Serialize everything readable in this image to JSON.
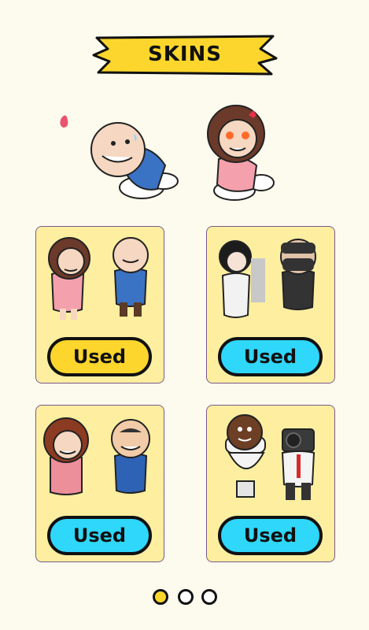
{
  "header": {
    "title": "SKINS"
  },
  "preview": {
    "left_character": "bald-man-on-plates",
    "right_character": "angry-woman-on-plates"
  },
  "skins": [
    {
      "name": "woman-and-bald-man",
      "button_label": "Used",
      "button_color": "#fcd62c"
    },
    {
      "name": "ghost-bride-and-ninja",
      "button_label": "Used",
      "button_color": "#2fd7fb"
    },
    {
      "name": "curly-aunt-and-bald-uncle",
      "button_label": "Used",
      "button_color": "#2fd7fb"
    },
    {
      "name": "toilet-head-and-camera-man",
      "button_label": "Used",
      "button_color": "#2fd7fb"
    }
  ],
  "pagination": {
    "pages": 3,
    "current": 1
  }
}
